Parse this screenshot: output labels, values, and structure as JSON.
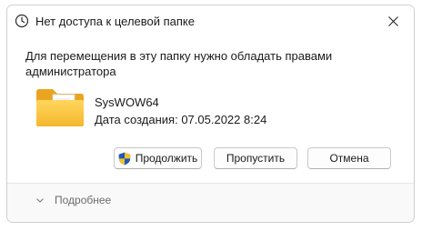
{
  "window": {
    "title": "Нет доступа к целевой папке",
    "title_icon": "clock-icon",
    "close_icon": "close-icon"
  },
  "message": "Для перемещения в эту папку нужно обладать правами администратора",
  "item": {
    "icon": "folder-icon",
    "name": "SysWOW64",
    "created": "Дата создания: 07.05.2022 8:24"
  },
  "buttons": {
    "continue": "Продолжить",
    "continue_icon": "uac-shield-icon",
    "skip": "Пропустить",
    "cancel": "Отмена"
  },
  "footer": {
    "details": "Подробнее",
    "details_icon": "chevron-down-icon"
  }
}
